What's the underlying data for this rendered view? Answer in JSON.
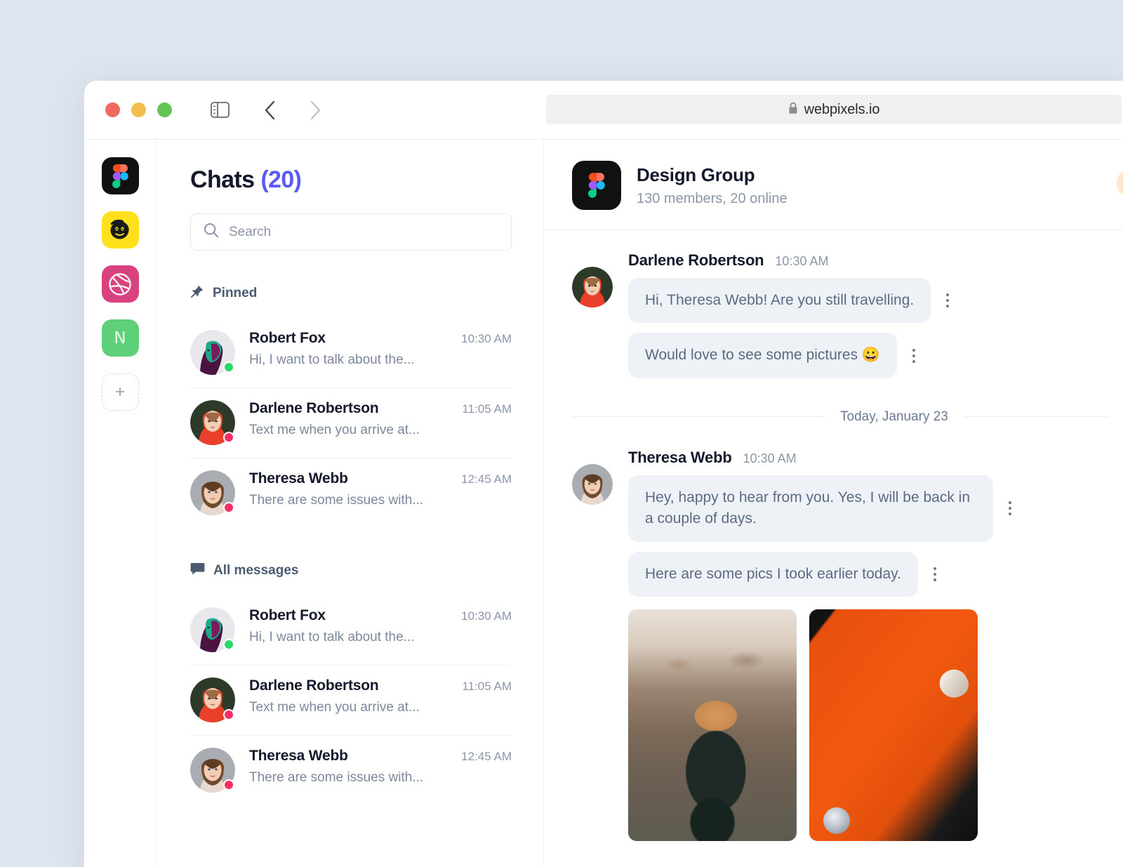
{
  "browser": {
    "url": "webpixels.io",
    "lock_icon": "lock-icon",
    "traffic_lights": [
      "close",
      "minimize",
      "zoom"
    ],
    "toolbar_icons": [
      "sidebar-toggle-icon",
      "back-arrow-icon",
      "forward-arrow-icon",
      "shield-icon"
    ]
  },
  "app_rail": {
    "items": [
      {
        "name": "figma",
        "label": "Figma",
        "color": "#111111"
      },
      {
        "name": "mailchimp",
        "label": "Mailchimp",
        "color": "#ffe01b"
      },
      {
        "name": "dribbble",
        "label": "Dribbble",
        "color": "#d8437f"
      },
      {
        "name": "notion",
        "label": "N",
        "color": "#5fd07a"
      }
    ],
    "add_label": "+"
  },
  "chat_list": {
    "title": "Chats",
    "count": "(20)",
    "count_color": "#5a5af5",
    "search": {
      "placeholder": "Search",
      "value": "",
      "icon": "search-icon"
    },
    "sections": [
      {
        "key": "pinned",
        "label": "Pinned",
        "icon": "pin-icon",
        "items": [
          {
            "name": "Robert Fox",
            "time": "10:30 AM",
            "preview": "Hi, I want to talk about the...",
            "presence": "online"
          },
          {
            "name": "Darlene Robertson",
            "time": "11:05 AM",
            "preview": "Text me when you arrive at...",
            "presence": "busy"
          },
          {
            "name": "Theresa Webb",
            "time": "12:45 AM",
            "preview": "There are some issues with...",
            "presence": "busy"
          }
        ]
      },
      {
        "key": "all",
        "label": "All messages",
        "icon": "chat-bubble-icon",
        "items": [
          {
            "name": "Robert Fox",
            "time": "10:30 AM",
            "preview": "Hi, I want to talk about the...",
            "presence": "online"
          },
          {
            "name": "Darlene Robertson",
            "time": "11:05 AM",
            "preview": "Text me when you arrive at...",
            "presence": "busy"
          },
          {
            "name": "Theresa Webb",
            "time": "12:45 AM",
            "preview": "There are some issues with...",
            "presence": "busy"
          }
        ]
      }
    ]
  },
  "conversation": {
    "group_name": "Design Group",
    "group_meta": "130 members, 20 online",
    "group_icon": "figma-icon",
    "date_divider": "Today, January 23",
    "groups": [
      {
        "sender": "Darlene Robertson",
        "time": "10:30 AM",
        "bubbles": [
          "Hi, Theresa Webb! Are you still travelling.",
          "Would love to see some pictures 😀"
        ]
      },
      {
        "sender": "Theresa Webb",
        "time": "10:30 AM",
        "bubbles": [
          "Hey, happy to hear from you. Yes, I will be back in a couple of days.",
          "Here are some pics I took earlier today."
        ],
        "photos": [
          "hiker-in-mountains",
          "orange-car"
        ]
      }
    ]
  }
}
